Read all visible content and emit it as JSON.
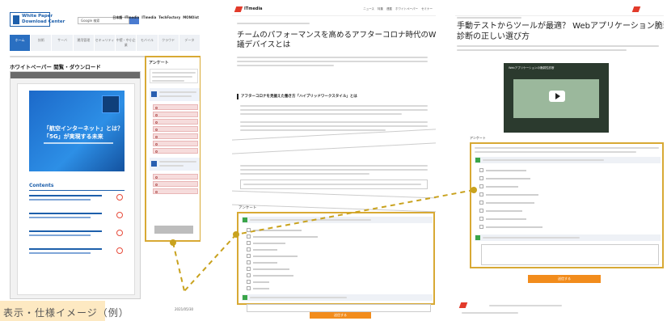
{
  "panel1": {
    "logo": {
      "line1": "White Paper",
      "line2": "Download Center"
    },
    "search_placeholder": "Google 検索",
    "header_logos": [
      "日本語",
      "ITmedia",
      "ITmedia",
      "TechFactory",
      "MONOist"
    ],
    "nav_tabs": [
      "ホーム",
      "技術",
      "サーバ",
      "運用管理",
      "セキュリティ",
      "中堅・中小企業",
      "モバイル",
      "クラウド",
      "データ"
    ],
    "page_title": "ホワイトペーパー 閲覧・ダウンロード",
    "cover_title_1": "「航空インターネット」とは？",
    "cover_title_2": "「5G」が実現する未来",
    "contents_heading": "Contents",
    "survey_heading": "アンケート",
    "ranking_label": "ホワイトペーパーダウンロードランキング",
    "ranking_date": "2021/05/30"
  },
  "panel2": {
    "brand": "ITmedia",
    "menu": [
      "ニュース",
      "特集",
      "連載",
      "ホワイトペーパー",
      "セミナー"
    ],
    "title_line1": "チームのパフォーマンスを高めるアフターコロナ時代のWeb会",
    "title_line2": "議デバイスとは",
    "section_heading": "アフターコロナを見据えた働き方「ハイブリッドワークスタイル」とは",
    "survey_heading": "アンケート",
    "submit": "送信する"
  },
  "panel3": {
    "title_line1": "手動テストからツールが最適？ Webアプリケーション脆弱性",
    "title_line2": "診断の正しい選び方",
    "video_caption": "Webアプリケーションの脆弱性診断",
    "survey_heading": "アンケート",
    "submit": "送信する"
  },
  "callout": {
    "text": "表示・仕様イメージ（例）"
  }
}
